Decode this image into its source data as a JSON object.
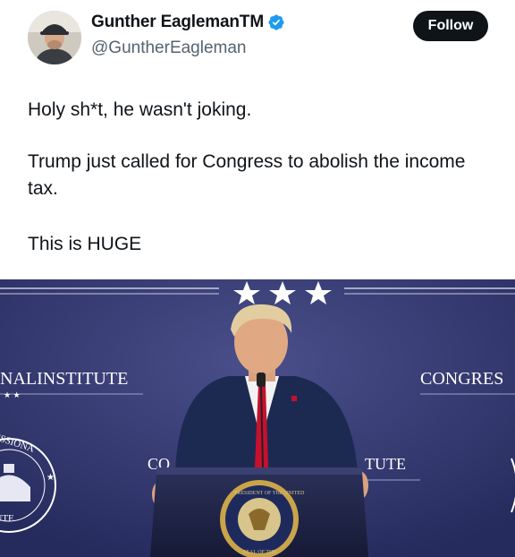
{
  "tweet": {
    "author": {
      "display_name": "Gunther Eagleman",
      "name_suffix": "TM",
      "handle": "@GuntherEagleman",
      "verified": true,
      "avatar": "profile-photo"
    },
    "follow_label": "Follow",
    "text_lines": [
      "Holy sh*t, he wasn't joking.",
      "Trump just called for Congress to abolish the income tax.",
      "This is HUGE"
    ],
    "media": {
      "description_icon": "photo",
      "backdrop_left": "NALINSTITUTE",
      "backdrop_right": "CONGRES",
      "backdrop_mid_left": "CO",
      "backdrop_mid_right": "TUTE",
      "seal_left_top": "ESSIONA",
      "seal_left_bottom": "ITUTE",
      "podium_seal_top": "PRESIDENT OF THE UNITED",
      "podium_seal_bottom": "SEAL OF THE",
      "colors": {
        "backdrop": "#2c3169",
        "podium": "#1f2547",
        "suit": "#1c2a52",
        "tie": "#c8102e"
      }
    }
  },
  "colors": {
    "text_primary": "#0f1419",
    "text_secondary": "#536471",
    "verified_blue": "#1d9bf0",
    "follow_bg": "#0f1419"
  }
}
